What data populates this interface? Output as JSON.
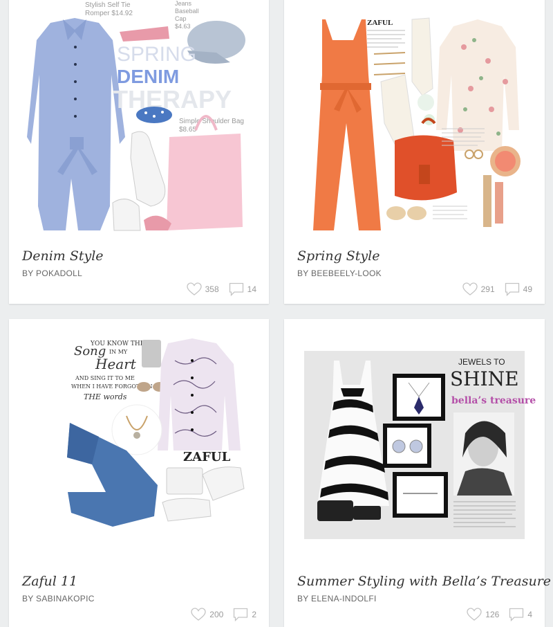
{
  "sets": [
    {
      "title": "Denim Style",
      "author": "BY POKADOLL",
      "likes": "358",
      "comments": "14",
      "image_text": {
        "spring": "SPRING",
        "denim": "DENIM",
        "therapy": "THERAPY",
        "item1": "Stylish Self Tie",
        "item1b": "Romper $14.92",
        "item2": "Jeans",
        "item2b": "Baseball",
        "item2c": "Cap",
        "item2d": "$4.63",
        "item3": "Simple Shoulder Bag",
        "item3b": "$8.65"
      }
    },
    {
      "title": "Spring Style",
      "author": "BY BEEBEELY-LOOK",
      "likes": "291",
      "comments": "49",
      "image_text": {
        "brand": "ZAFUL"
      }
    },
    {
      "title": "Zaful 11",
      "author": "BY SABINAKOPIC",
      "likes": "200",
      "comments": "2",
      "image_text": {
        "q1": "YOU KNOW THE",
        "q2": "Song",
        "q3": "IN MY",
        "q4": "Heart",
        "q5": "AND SING IT TO ME",
        "q6": "WHEN I HAVE FORGOTTEN",
        "q7": "THE words",
        "brand": "ZAFUL"
      }
    },
    {
      "title": "Summer Styling with Bella’s Treasure",
      "author": "BY ELENA-INDOLFI",
      "likes": "126",
      "comments": "4",
      "image_text": {
        "jewels": "JEWELS TO",
        "shine": "SHINE",
        "bella": "bella’s treasure"
      }
    }
  ],
  "colors": {
    "background": "#eceeef",
    "card": "#ffffff",
    "icon": "#9a9a9a"
  },
  "icons": {
    "like": "heart-icon",
    "comment": "comment-icon"
  }
}
